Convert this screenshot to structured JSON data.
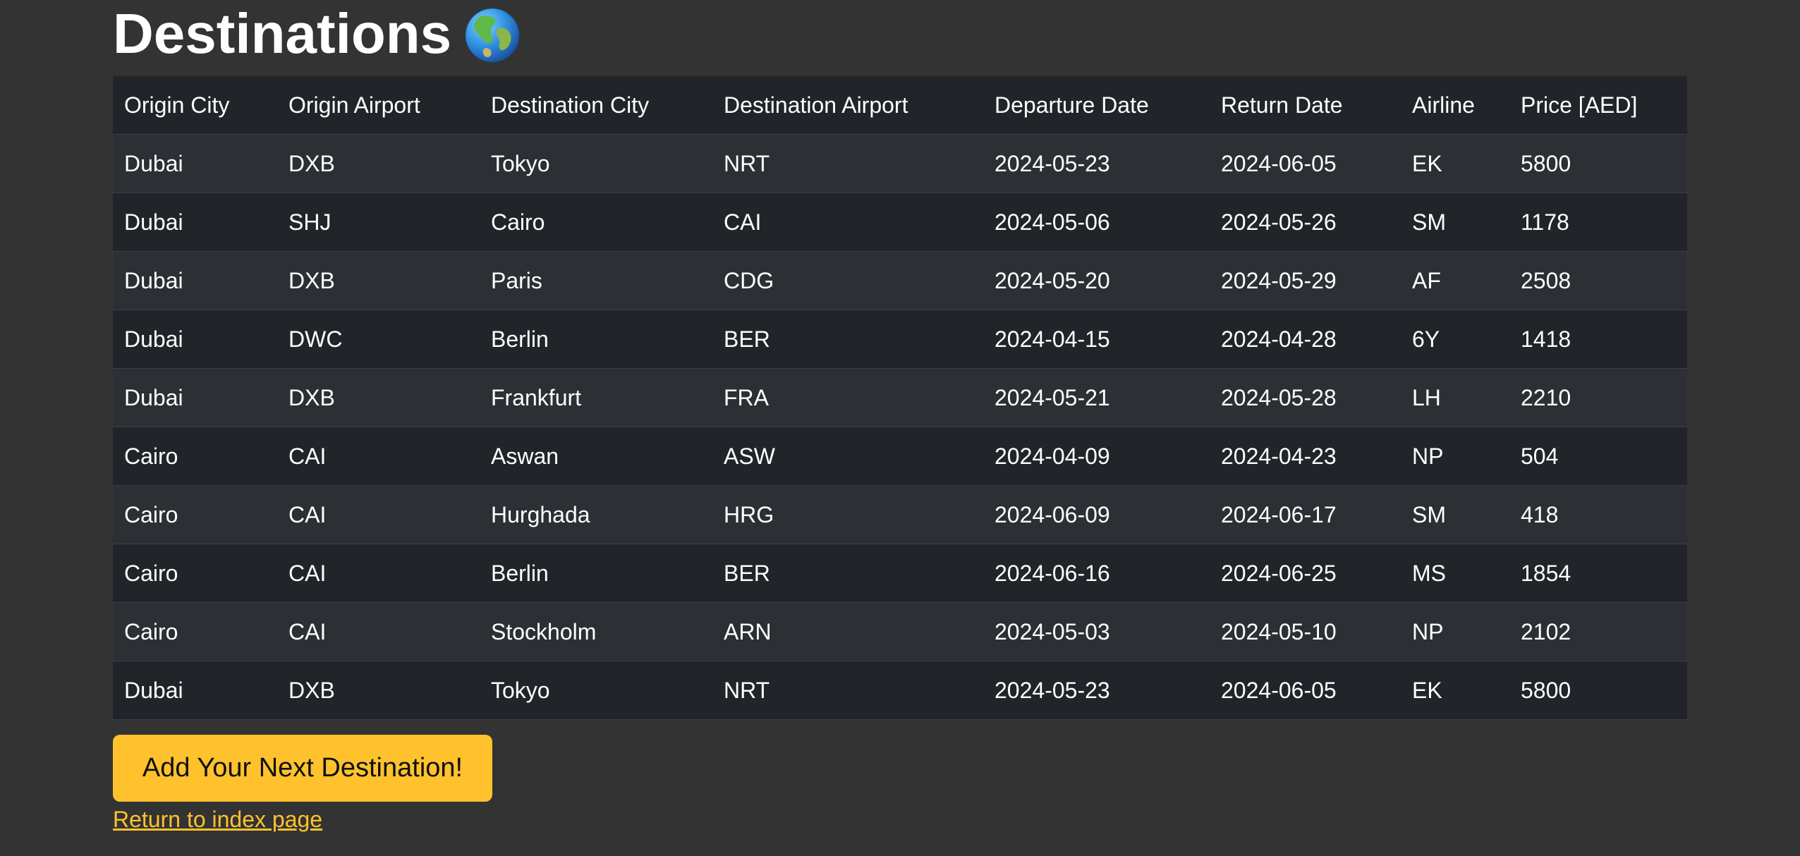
{
  "page": {
    "title": "Destinations",
    "title_icon": "globe-icon"
  },
  "table": {
    "headers": [
      "Origin City",
      "Origin Airport",
      "Destination City",
      "Destination Airport",
      "Departure Date",
      "Return Date",
      "Airline",
      "Price [AED]"
    ],
    "rows": [
      [
        "Dubai",
        "DXB",
        "Tokyo",
        "NRT",
        "2024-05-23",
        "2024-06-05",
        "EK",
        "5800"
      ],
      [
        "Dubai",
        "SHJ",
        "Cairo",
        "CAI",
        "2024-05-06",
        "2024-05-26",
        "SM",
        "1178"
      ],
      [
        "Dubai",
        "DXB",
        "Paris",
        "CDG",
        "2024-05-20",
        "2024-05-29",
        "AF",
        "2508"
      ],
      [
        "Dubai",
        "DWC",
        "Berlin",
        "BER",
        "2024-04-15",
        "2024-04-28",
        "6Y",
        "1418"
      ],
      [
        "Dubai",
        "DXB",
        "Frankfurt",
        "FRA",
        "2024-05-21",
        "2024-05-28",
        "LH",
        "2210"
      ],
      [
        "Cairo",
        "CAI",
        "Aswan",
        "ASW",
        "2024-04-09",
        "2024-04-23",
        "NP",
        "504"
      ],
      [
        "Cairo",
        "CAI",
        "Hurghada",
        "HRG",
        "2024-06-09",
        "2024-06-17",
        "SM",
        "418"
      ],
      [
        "Cairo",
        "CAI",
        "Berlin",
        "BER",
        "2024-06-16",
        "2024-06-25",
        "MS",
        "1854"
      ],
      [
        "Cairo",
        "CAI",
        "Stockholm",
        "ARN",
        "2024-05-03",
        "2024-05-10",
        "NP",
        "2102"
      ],
      [
        "Dubai",
        "DXB",
        "Tokyo",
        "NRT",
        "2024-05-23",
        "2024-06-05",
        "EK",
        "5800"
      ]
    ]
  },
  "actions": {
    "add_button_label": "Add Your Next Destination!",
    "return_link_label": "Return to index page"
  },
  "colors": {
    "background": "#333333",
    "accent": "#ffc22d",
    "row_dark": "#212529",
    "row_light": "#2c3034"
  }
}
